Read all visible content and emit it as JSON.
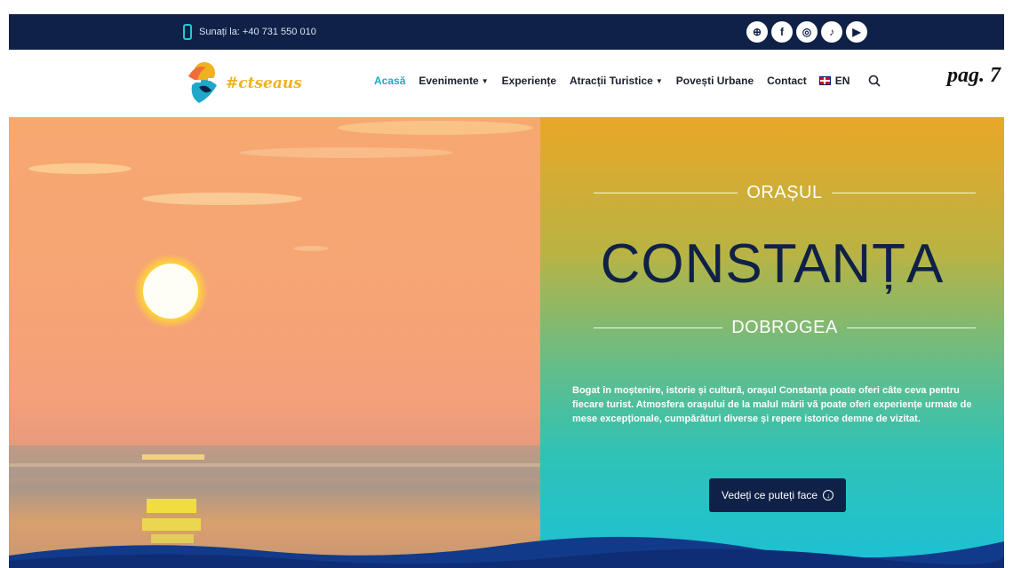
{
  "page_label": "pag. 7",
  "topbar": {
    "phone": "Sunați la: +40 731 550 010",
    "socials": [
      {
        "icon": "globe-icon",
        "glyph": "⊕"
      },
      {
        "icon": "facebook-icon",
        "glyph": "f"
      },
      {
        "icon": "instagram-icon",
        "glyph": "◎"
      },
      {
        "icon": "tiktok-icon",
        "glyph": "♪"
      },
      {
        "icon": "youtube-icon",
        "glyph": "▶"
      }
    ]
  },
  "header": {
    "logo_text": "#ctseaus",
    "nav": [
      {
        "label": "Acasă",
        "active": true,
        "dropdown": false
      },
      {
        "label": "Evenimente",
        "active": false,
        "dropdown": true
      },
      {
        "label": "Experiențe",
        "active": false,
        "dropdown": false
      },
      {
        "label": "Atracții Turistice",
        "active": false,
        "dropdown": true
      },
      {
        "label": "Povești Urbane",
        "active": false,
        "dropdown": false
      },
      {
        "label": "Contact",
        "active": false,
        "dropdown": false
      }
    ],
    "language": "EN"
  },
  "hero": {
    "subtitle_top": "ORAȘUL",
    "title": "CONSTANȚA",
    "subtitle_bottom": "DOBROGEA",
    "description": "Bogat în moștenire, istorie și cultură, orașul Constanța poate oferi câte ceva pentru fiecare turist. Atmosfera orașului de la malul mării vă poate oferi experiențe urmate de mese excepționale, cumpărături diverse și repere istorice demne de vizitat.",
    "cta_label": "Vedeți ce puteți face"
  },
  "colors": {
    "navy": "#0f2147",
    "accent": "#1fa8c9",
    "logo_yellow": "#f0b21e"
  }
}
